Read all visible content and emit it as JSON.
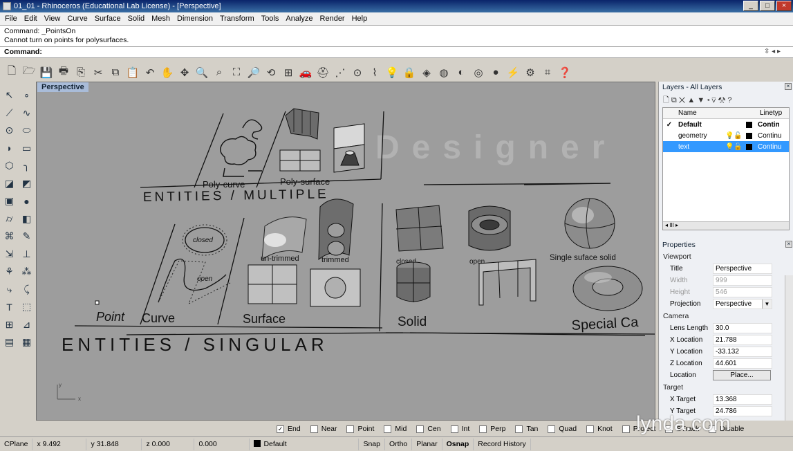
{
  "window": {
    "title": "01_01 - Rhinoceros (Educational Lab License) - [Perspective]",
    "minimize": "_",
    "maximize": "□",
    "close": "×"
  },
  "menu": [
    "File",
    "Edit",
    "View",
    "Curve",
    "Surface",
    "Solid",
    "Mesh",
    "Dimension",
    "Transform",
    "Tools",
    "Analyze",
    "Render",
    "Help"
  ],
  "command": {
    "history": [
      "Command: _PointsOn",
      "Cannot turn on points for polysurfaces."
    ],
    "prompt": "Command:",
    "scroll_glyphs": "⇳  ◂  ▸"
  },
  "toolbar_icons": [
    {
      "name": "new-document-icon",
      "glyph": "🗋"
    },
    {
      "name": "open-icon",
      "glyph": "🗁"
    },
    {
      "name": "save-icon",
      "glyph": "💾"
    },
    {
      "name": "print-icon",
      "glyph": "🖶"
    },
    {
      "name": "import-icon",
      "glyph": "⎘"
    },
    {
      "name": "cut-icon",
      "glyph": "✂"
    },
    {
      "name": "copy-icon",
      "glyph": "⧉"
    },
    {
      "name": "paste-icon",
      "glyph": "📋"
    },
    {
      "name": "undo-icon",
      "glyph": "↶"
    },
    {
      "name": "pan-icon",
      "glyph": "✋"
    },
    {
      "name": "rotate-view-icon",
      "glyph": "✥"
    },
    {
      "name": "zoom-icon",
      "glyph": "🔍"
    },
    {
      "name": "zoom-window-icon",
      "glyph": "⌕"
    },
    {
      "name": "zoom-extents-icon",
      "glyph": "⛶"
    },
    {
      "name": "zoom-selected-icon",
      "glyph": "🔎"
    },
    {
      "name": "undo-view-icon",
      "glyph": "⟲"
    },
    {
      "name": "four-viewports-icon",
      "glyph": "⊞"
    },
    {
      "name": "car-icon",
      "glyph": "🚗"
    },
    {
      "name": "hat-icon",
      "glyph": "⛑"
    },
    {
      "name": "select-points-icon",
      "glyph": "⋰"
    },
    {
      "name": "point-on-icon",
      "glyph": "⊙"
    },
    {
      "name": "curve-points-icon",
      "glyph": "⌇"
    },
    {
      "name": "light-bulb-icon",
      "glyph": "💡"
    },
    {
      "name": "lock-icon",
      "glyph": "🔒"
    },
    {
      "name": "layer-icon",
      "glyph": "◈"
    },
    {
      "name": "color-wheel-icon",
      "glyph": "◍"
    },
    {
      "name": "shade-icon",
      "glyph": "◐"
    },
    {
      "name": "render-sphere-icon",
      "glyph": "◎"
    },
    {
      "name": "render-icon",
      "glyph": "●"
    },
    {
      "name": "snap-icon",
      "glyph": "⚡"
    },
    {
      "name": "options-icon",
      "glyph": "⚙"
    },
    {
      "name": "grid-snap-icon",
      "glyph": "⌗"
    },
    {
      "name": "help-icon",
      "glyph": "❓"
    }
  ],
  "left_tools": [
    {
      "name": "select-arrow-icon",
      "glyph": "↖"
    },
    {
      "name": "point-icon",
      "glyph": "∘"
    },
    {
      "name": "polyline-icon",
      "glyph": "⟋"
    },
    {
      "name": "curve-icon",
      "glyph": "∿"
    },
    {
      "name": "circle-icon",
      "glyph": "⊙"
    },
    {
      "name": "ellipse-icon",
      "glyph": "⬭"
    },
    {
      "name": "arc-icon",
      "glyph": "◗"
    },
    {
      "name": "rectangle-icon",
      "glyph": "▭"
    },
    {
      "name": "polygon-icon",
      "glyph": "⬡"
    },
    {
      "name": "fillet-icon",
      "glyph": "╮"
    },
    {
      "name": "surface-icon",
      "glyph": "◪"
    },
    {
      "name": "loft-icon",
      "glyph": "◩"
    },
    {
      "name": "box-icon",
      "glyph": "▣"
    },
    {
      "name": "sphere-icon",
      "glyph": "●"
    },
    {
      "name": "cylinder-icon",
      "glyph": "⌭"
    },
    {
      "name": "extrude-icon",
      "glyph": "◧"
    },
    {
      "name": "mesh-icon",
      "glyph": "⌘"
    },
    {
      "name": "boolean-icon",
      "glyph": "✎"
    },
    {
      "name": "transform-icon",
      "glyph": "⇲"
    },
    {
      "name": "align-icon",
      "glyph": "⊥"
    },
    {
      "name": "group-icon",
      "glyph": "⚘"
    },
    {
      "name": "array-icon",
      "glyph": "⁂"
    },
    {
      "name": "trim-icon",
      "glyph": "⤷"
    },
    {
      "name": "split-icon",
      "glyph": "⤹"
    },
    {
      "name": "text-icon",
      "glyph": "T"
    },
    {
      "name": "dimension-icon",
      "glyph": "⬚"
    },
    {
      "name": "block-icon",
      "glyph": "⊞"
    },
    {
      "name": "analyze-icon",
      "glyph": "⊿"
    },
    {
      "name": "render-box-icon",
      "glyph": "▤"
    },
    {
      "name": "hatch-icon",
      "glyph": "▦"
    }
  ],
  "viewport": {
    "label": "Perspective",
    "scene_text": {
      "polycurve": "Poly-curve",
      "polysurface": "Poly-surface",
      "multiple": "ENTITIES / MULTIPLE",
      "singular": "ENTITIES / SINGULAR",
      "point": "Point",
      "curve": "Curve",
      "surface": "Surface",
      "solid": "Solid",
      "special": "Special Ca",
      "closed": "closed",
      "open": "open",
      "untrimmed": "un-trimmed",
      "trimmed": "trimmed",
      "closed2": "closed",
      "open2": "open",
      "single_surface_solid": "Single suface solid",
      "axis_y": "y",
      "axis_x": "x"
    },
    "watermark": "Designer"
  },
  "layers": {
    "title": "Layers - All Layers",
    "tools": "🗋 ⧉ ✕ ▲ ▼ ◂ ⊽ ⚒ ?",
    "columns": {
      "name": "Name",
      "linetype": "Linetyp"
    },
    "rows": [
      {
        "check": "✓",
        "name": "Default",
        "linetype": "Contin",
        "selected": false,
        "bold": true
      },
      {
        "check": "",
        "name": "geometry",
        "linetype": "Continu",
        "selected": false,
        "bold": false
      },
      {
        "check": "",
        "name": "text",
        "linetype": "Continu",
        "selected": true,
        "bold": false
      }
    ],
    "hscroll": "◂ III ▸"
  },
  "properties": {
    "title": "Properties",
    "section": "Viewport",
    "rows": [
      {
        "label": "Title",
        "value": "Perspective",
        "dim": false
      },
      {
        "label": "Width",
        "value": "999",
        "dim": true
      },
      {
        "label": "Height",
        "value": "546",
        "dim": true
      },
      {
        "label": "Projection",
        "value": "Perspective",
        "dim": false,
        "dropdown": true
      }
    ],
    "camera_title": "Camera",
    "camera": [
      {
        "label": "Lens Length",
        "value": "30.0"
      },
      {
        "label": "X Location",
        "value": "21.788"
      },
      {
        "label": "Y Location",
        "value": "-33.132"
      },
      {
        "label": "Z Location",
        "value": "44.601"
      }
    ],
    "location_label": "Location",
    "place_button": "Place...",
    "target_title": "Target",
    "target": [
      {
        "label": "X Target",
        "value": "13.368"
      },
      {
        "label": "Y Target",
        "value": "24.786"
      }
    ]
  },
  "osnap": [
    {
      "label": "End",
      "checked": true
    },
    {
      "label": "Near",
      "checked": false
    },
    {
      "label": "Point",
      "checked": false
    },
    {
      "label": "Mid",
      "checked": false
    },
    {
      "label": "Cen",
      "checked": false
    },
    {
      "label": "Int",
      "checked": false
    },
    {
      "label": "Perp",
      "checked": false
    },
    {
      "label": "Tan",
      "checked": false
    },
    {
      "label": "Quad",
      "checked": false
    },
    {
      "label": "Knot",
      "checked": false
    },
    {
      "label": "Project",
      "checked": false
    },
    {
      "label": "STrack",
      "checked": false
    },
    {
      "label": "Disable",
      "checked": false
    }
  ],
  "status": {
    "cplane": "CPlane",
    "x": "x 9.492",
    "y": "y 31.848",
    "z": "z 0.000",
    "d": "0.000",
    "layer": "Default",
    "snap": "Snap",
    "ortho": "Ortho",
    "planar": "Planar",
    "osnap": "Osnap",
    "history": "Record History"
  },
  "watermark": "lynda.com"
}
